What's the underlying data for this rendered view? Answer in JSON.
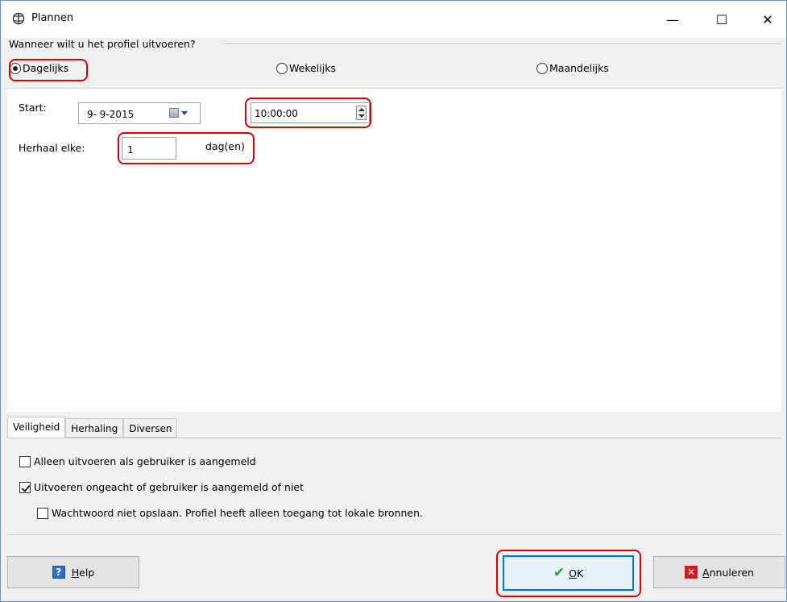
{
  "window": {
    "title": "Plannen",
    "icon": "app-sync-icon",
    "minimize_glyph": "—",
    "maximize_glyph": "☐",
    "close_glyph": "✕"
  },
  "frequency": {
    "question": "Wanneer wilt u het profiel uitvoeren?",
    "options": [
      {
        "label": "Dagelijks",
        "checked": true
      },
      {
        "label": "Wekelijks",
        "checked": false
      },
      {
        "label": "Maandelijks",
        "checked": false
      }
    ]
  },
  "schedule": {
    "start_label": "Start:",
    "start_date": "9- 9-2015",
    "start_time": "10:00:00",
    "repeat_label": "Herhaal elke:",
    "repeat_value": "1",
    "repeat_unit": "dag(en)"
  },
  "tabs": [
    {
      "label": "Veiligheid",
      "active": true
    },
    {
      "label": "Herhaling",
      "active": false
    },
    {
      "label": "Diversen",
      "active": false
    }
  ],
  "security": {
    "options": [
      {
        "label": "Alleen uitvoeren als gebruiker is aangemeld",
        "checked": false
      },
      {
        "label": "Uitvoeren ongeacht of gebruiker is aangemeld of niet",
        "checked": true
      },
      {
        "label": "Wachtwoord niet opslaan. Profiel heeft alleen toegang tot lokale bronnen.",
        "checked": false
      }
    ]
  },
  "buttons": {
    "help": "Help",
    "ok": "OK",
    "cancel": "Annuleren"
  },
  "colors": {
    "highlight": "#e00000",
    "accent": "#0078d7"
  }
}
